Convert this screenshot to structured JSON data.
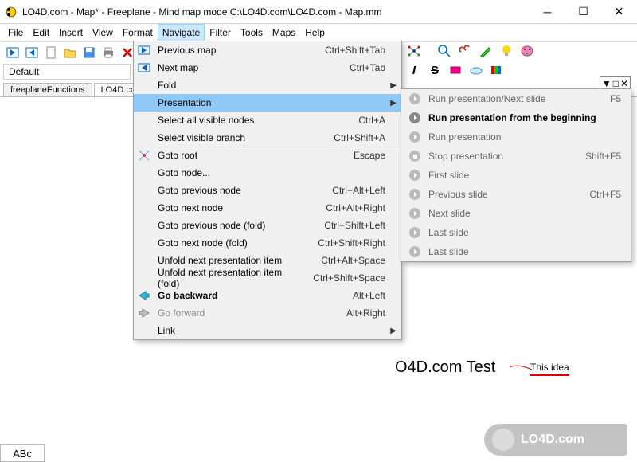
{
  "window": {
    "title": "LO4D.com - Map* - Freeplane - Mind map mode C:\\LO4D.com\\LO4D.com - Map.mm"
  },
  "menubar": [
    "File",
    "Edit",
    "Insert",
    "View",
    "Format",
    "Navigate",
    "Filter",
    "Tools",
    "Maps",
    "Help"
  ],
  "menubar_active_index": 5,
  "default_label": "Default",
  "tabs": [
    {
      "label": "freeplaneFunctions",
      "active": false
    },
    {
      "label": "LO4D.com - M",
      "active": true
    }
  ],
  "navigate_menu": [
    {
      "label": "Previous map",
      "shortcut": "Ctrl+Shift+Tab",
      "icon": "prev-map"
    },
    {
      "label": "Next map",
      "shortcut": "Ctrl+Tab",
      "icon": "next-map"
    },
    {
      "label": "Fold",
      "submenu": true,
      "sep_after": true
    },
    {
      "label": "Presentation",
      "submenu": true,
      "highlight": true,
      "sep_after": true
    },
    {
      "label": "Select all visible nodes",
      "shortcut": "Ctrl+A"
    },
    {
      "label": "Select visible branch",
      "shortcut": "Ctrl+Shift+A",
      "sep_after": true
    },
    {
      "label": "Goto root",
      "shortcut": "Escape",
      "icon": "goto-root"
    },
    {
      "label": "Goto node..."
    },
    {
      "label": "Goto previous node",
      "shortcut": "Ctrl+Alt+Left"
    },
    {
      "label": "Goto next node",
      "shortcut": "Ctrl+Alt+Right"
    },
    {
      "label": "Goto previous node (fold)",
      "shortcut": "Ctrl+Shift+Left"
    },
    {
      "label": "Goto next node (fold)",
      "shortcut": "Ctrl+Shift+Right"
    },
    {
      "label": "Unfold next presentation item",
      "shortcut": "Ctrl+Alt+Space"
    },
    {
      "label": "Unfold next presentation item (fold)",
      "shortcut": "Ctrl+Shift+Space"
    },
    {
      "label": "Go backward",
      "shortcut": "Alt+Left",
      "bold": true,
      "icon": "back"
    },
    {
      "label": "Go forward",
      "shortcut": "Alt+Right",
      "disabled": true,
      "icon": "forward"
    },
    {
      "label": "Link",
      "submenu": true
    }
  ],
  "presentation_submenu": [
    {
      "label": "Run presentation/Next slide",
      "shortcut": "F5"
    },
    {
      "label": "Run presentation from the beginning",
      "bold": true
    },
    {
      "label": "Run presentation"
    },
    {
      "label": "Stop presentation",
      "shortcut": "Shift+F5",
      "stop": true
    },
    {
      "label": "First slide"
    },
    {
      "label": "Previous slide",
      "shortcut": "Ctrl+F5"
    },
    {
      "label": "Next slide"
    },
    {
      "label": "Last slide"
    },
    {
      "label": "Last slide"
    }
  ],
  "mindmap": {
    "main_node": "O4D.com Test",
    "idea_node": "This idea"
  },
  "statusbar": "ABc",
  "watermark": "LO4D.com"
}
